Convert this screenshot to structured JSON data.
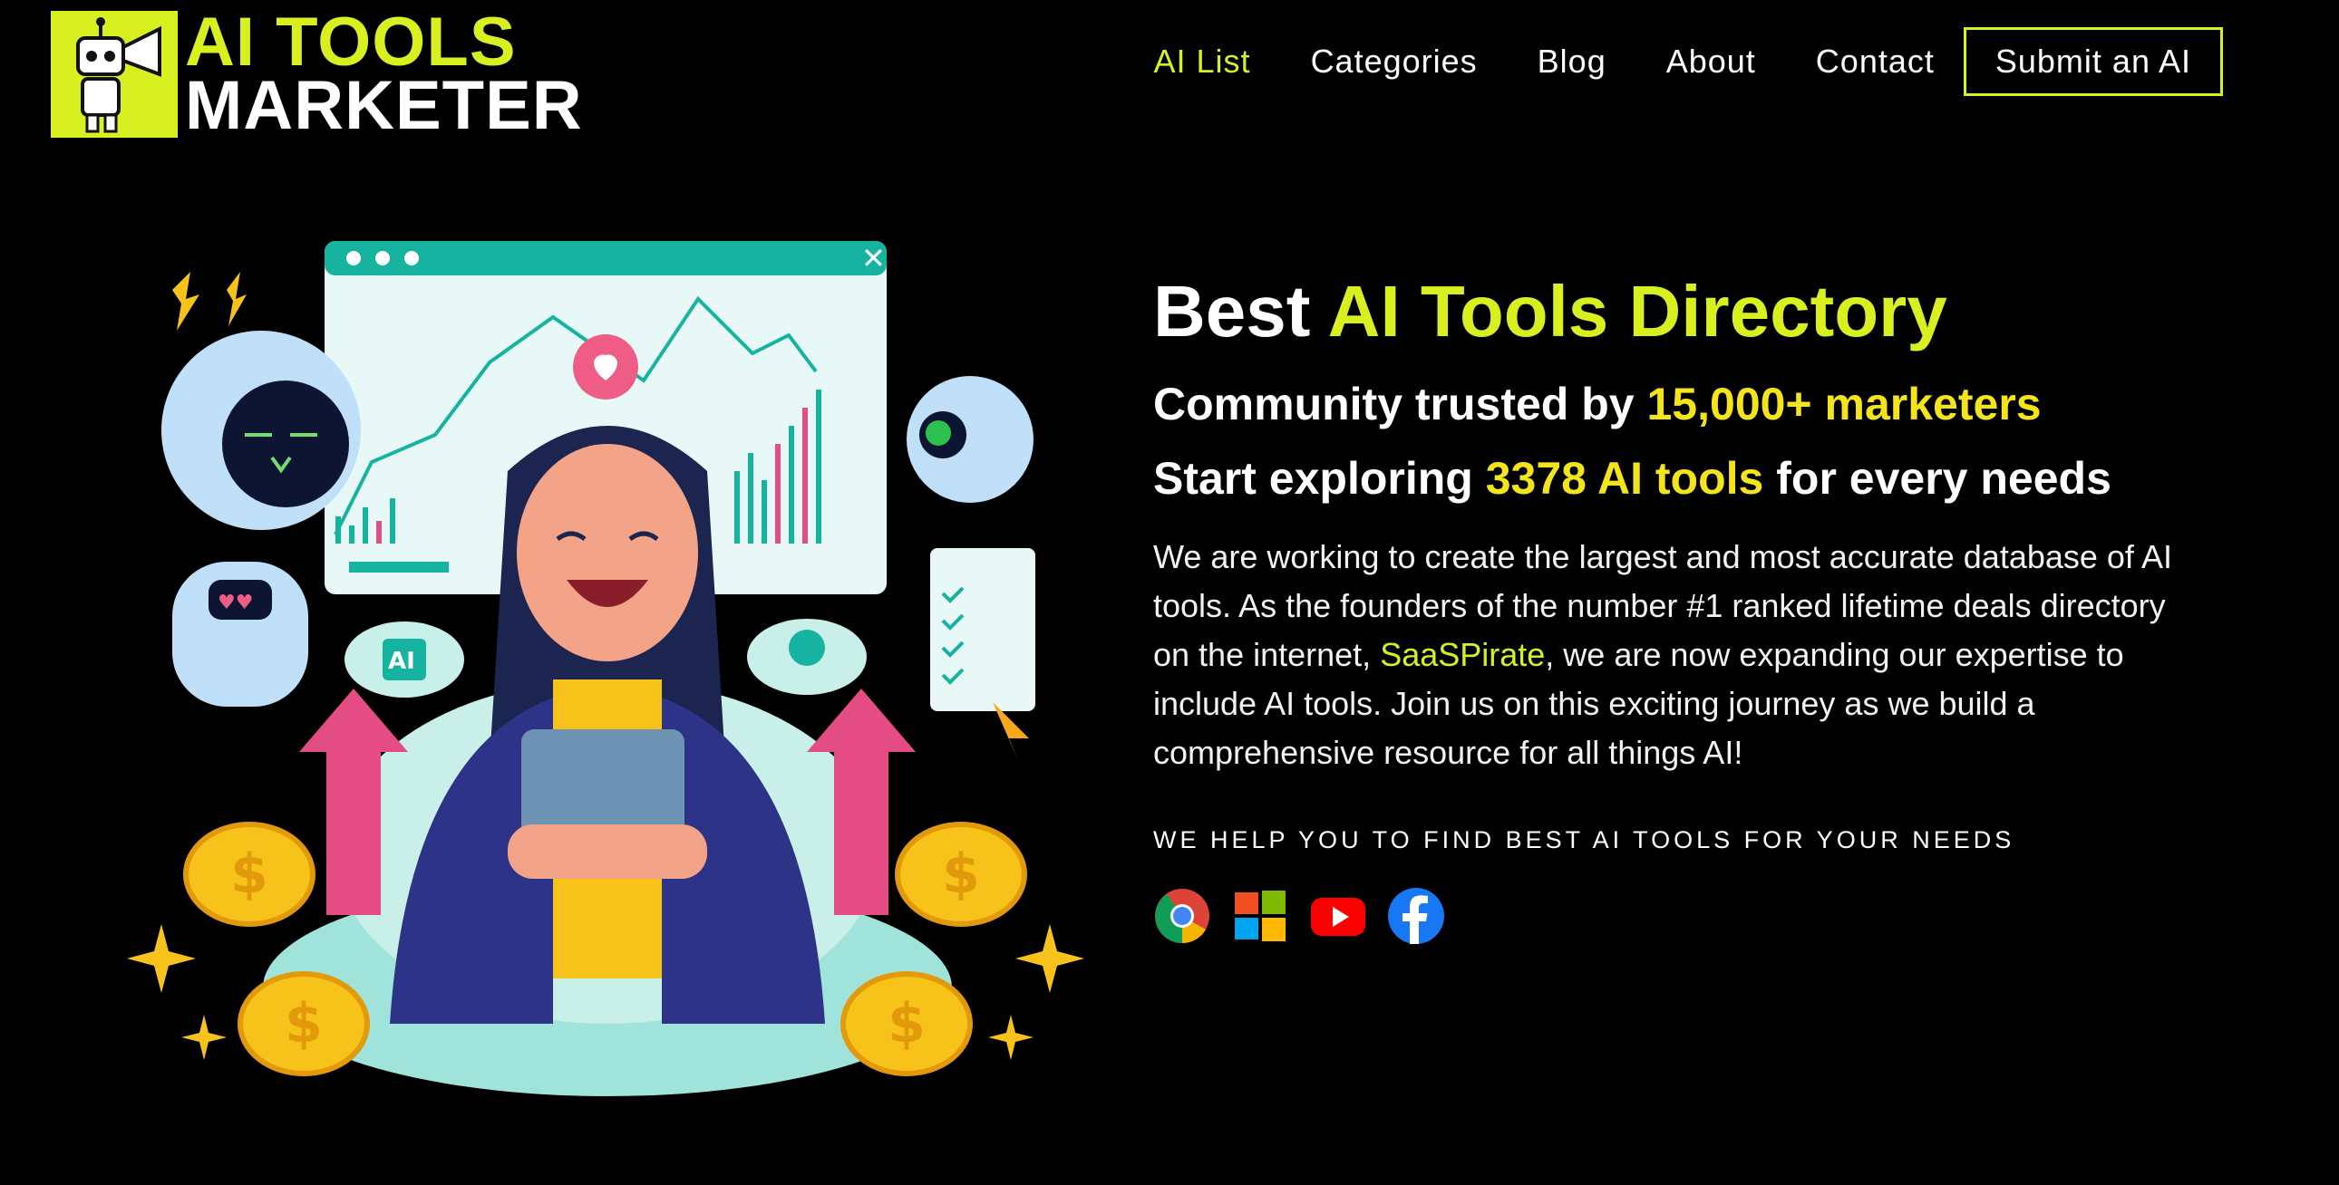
{
  "logo": {
    "line1": "AI TOOLS",
    "line2": "MARKETER"
  },
  "nav": {
    "items": [
      {
        "label": "AI List",
        "active": true
      },
      {
        "label": "Categories"
      },
      {
        "label": "Blog"
      },
      {
        "label": "About"
      },
      {
        "label": "Contact"
      }
    ],
    "submit_label": "Submit an AI"
  },
  "hero": {
    "title_prefix": "Best",
    "title_accent": "AI Tools Directory",
    "line2_prefix": "Community trusted by",
    "line2_accent": "15,000+ marketers",
    "line3_prefix": "Start exploring",
    "line3_accent": "3378 AI tools",
    "line3_suffix": "for every needs",
    "paragraph_part1": "We are working to create the largest and most accurate database of AI tools. As the founders of the number #1 ranked lifetime deals directory on the internet,",
    "paragraph_link": "SaaSPirate",
    "paragraph_part2": ", we are now expanding our expertise to include AI tools. Join us on this exciting journey as we build a comprehensive resource for all things AI!",
    "tagline": "WE HELP YOU TO FIND BEST AI TOOLS FOR YOUR NEEDS",
    "art_ai_label": "AI"
  },
  "platform_icons": [
    "chrome-icon",
    "windows-icon",
    "youtube-icon",
    "facebook-icon"
  ],
  "colors": {
    "accent": "#d8f01f",
    "highlight": "#f4e51a",
    "background": "#000000"
  }
}
